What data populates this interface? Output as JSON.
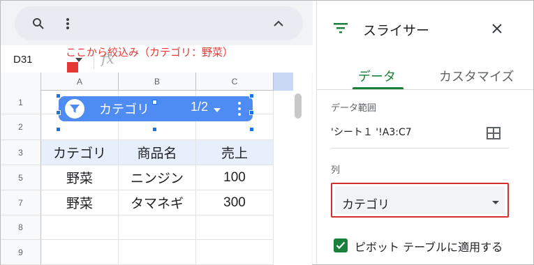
{
  "toolbar": {
    "search_icon": "search-icon",
    "more_icon": "more-vert-icon",
    "collapse_icon": "chevron-up-icon"
  },
  "formula_bar": {
    "name_box": "D31",
    "fx_label": "fx"
  },
  "annotation": {
    "text": "ここから絞込み（カテゴリ：野菜）",
    "color": "#e53935"
  },
  "sheet": {
    "columns": [
      "A",
      "B",
      "C"
    ],
    "rows": [
      {
        "num": "1",
        "cells": [
          "",
          "",
          ""
        ]
      },
      {
        "num": "2",
        "cells": [
          "",
          "",
          ""
        ]
      },
      {
        "num": "3",
        "cells": [
          "カテゴリ",
          "商品名",
          "売上"
        ]
      },
      {
        "num": "5",
        "cells": [
          "野菜",
          "ニンジン",
          "100"
        ]
      },
      {
        "num": "7",
        "cells": [
          "野菜",
          "タマネギ",
          "300"
        ]
      },
      {
        "num": "8",
        "cells": [
          "",
          "",
          ""
        ]
      },
      {
        "num": "9",
        "cells": [
          "",
          "",
          ""
        ]
      }
    ],
    "header_fill": "#e6effb"
  },
  "slicer": {
    "label": "カテゴリ",
    "count": "1/2",
    "color": "#4e8bf3"
  },
  "panel": {
    "title": "スライサー",
    "tabs": [
      "データ",
      "カスタマイズ"
    ],
    "active_tab": "データ",
    "data_range_label": "データ範囲",
    "data_range_value": "'シート１ '!A3:C7",
    "column_label": "列",
    "column_value": "カテゴリ",
    "pivot_checkbox_label": "ピボット テーブルに適用する",
    "pivot_checked": true,
    "accent_color": "#188038",
    "highlight_color": "#d32f2f"
  }
}
